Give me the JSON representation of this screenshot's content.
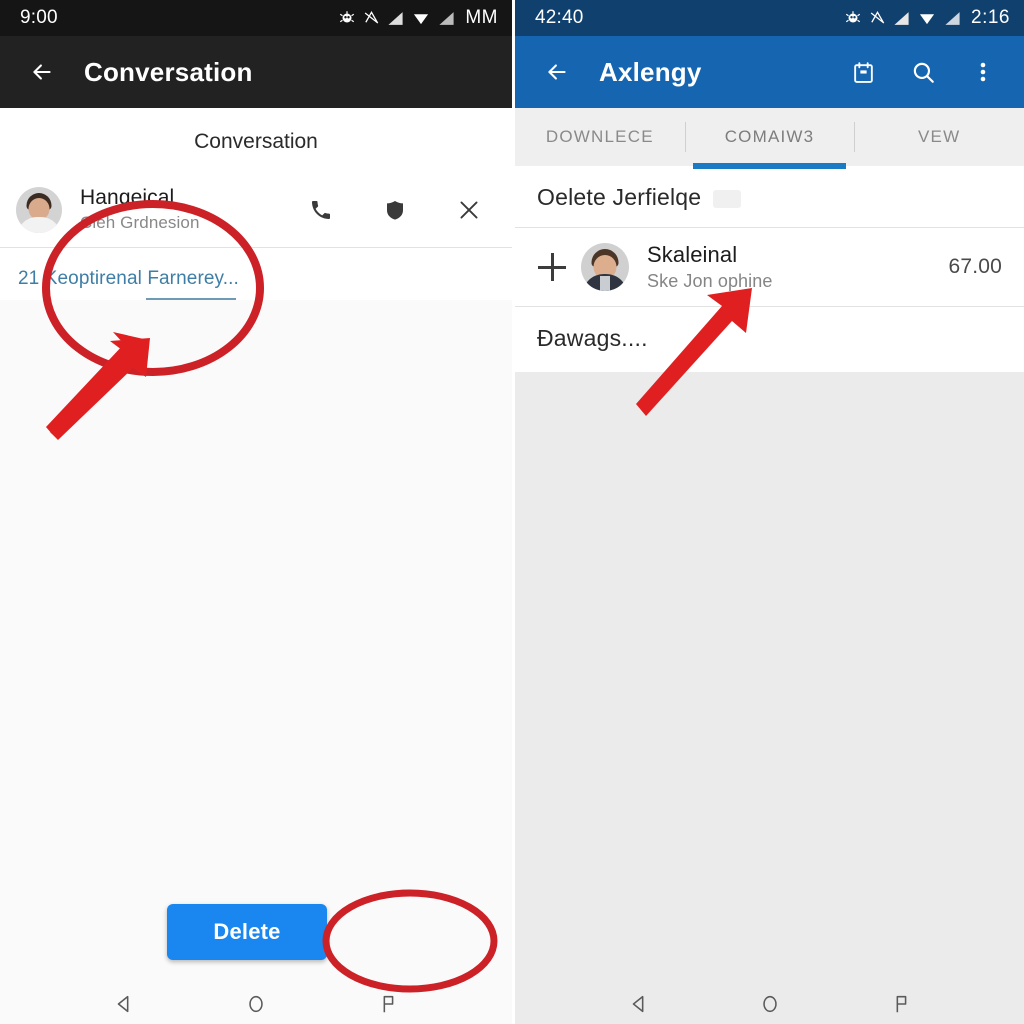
{
  "left_screen": {
    "status_bar": {
      "clock": "9:00",
      "right_label": "MM",
      "icons": [
        "bug-icon",
        "location-off-icon",
        "signal-bars-icon",
        "wifi-icon",
        "signal-bars-2-icon"
      ]
    },
    "app_bar": {
      "back_icon": "back-arrow-icon",
      "title": "Conversation"
    },
    "section_title": "Conversation",
    "conversation": {
      "avatar": "contact-avatar",
      "name": "Hangeical",
      "subtitle": "Cleh Grdnesion",
      "actions": [
        {
          "icon": "phone-icon",
          "name": "call-button"
        },
        {
          "icon": "shield-icon",
          "name": "block-button"
        },
        {
          "icon": "close-icon",
          "name": "close-button"
        }
      ]
    },
    "link": {
      "text": "21 Keoptirenal Farnerey..."
    },
    "delete_button": "Delete",
    "nav": [
      "back-triangle-icon",
      "home-circle-icon",
      "recents-flag-icon"
    ]
  },
  "right_screen": {
    "status_bar": {
      "clock": "42:40",
      "right_label": "2:16",
      "icons": [
        "bug-icon",
        "location-off-icon",
        "signal-bars-icon",
        "wifi-icon",
        "signal-bars-2-icon"
      ]
    },
    "app_bar": {
      "back_icon": "back-arrow-icon",
      "title": "Axlengy",
      "actions": [
        {
          "icon": "calendar-icon",
          "name": "calendar-button"
        },
        {
          "icon": "search-icon",
          "name": "search-button"
        },
        {
          "icon": "overflow-menu-icon",
          "name": "overflow-menu-button"
        }
      ]
    },
    "tabs": [
      {
        "label": "DOWNLECE",
        "active": false
      },
      {
        "label": "COMAIW3",
        "active": true
      },
      {
        "label": "VEW",
        "active": false
      }
    ],
    "section_header": "Oelete Jerfielqe",
    "list_item": {
      "leading_icon": "plus-icon",
      "avatar": "person-avatar",
      "title": "Skaleinal",
      "subtitle": "Ske Jon ophine",
      "amount": "67.00"
    },
    "footer_text": "Ðawags....",
    "nav": [
      "back-triangle-icon",
      "home-circle-icon",
      "recents-flag-icon"
    ]
  },
  "annotations": {
    "accent_color": "#cc2127",
    "circle_link_highlight": "ellipse-annotation-link",
    "arrow_to_link": "arrow-annotation-link",
    "circle_delete_highlight": "ellipse-annotation-delete",
    "arrow_to_list_item": "arrow-annotation-list-item"
  },
  "colors": {
    "left_statusbar": "#151515",
    "left_appbar": "#222222",
    "right_statusbar": "#10406e",
    "right_appbar": "#1565b0",
    "tab_indicator": "#1b7ac4",
    "delete_button": "#1a86ef",
    "link_text": "#3e7ea6",
    "annotation_red": "#cc2127"
  }
}
